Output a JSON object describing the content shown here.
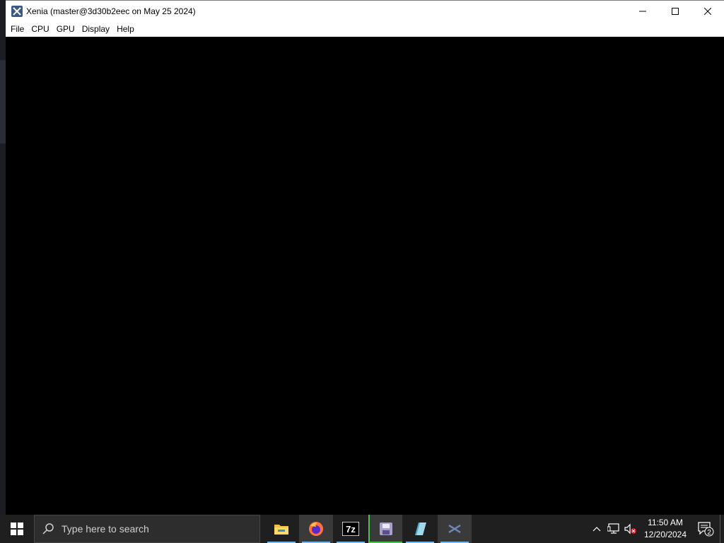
{
  "window": {
    "title": "Xenia (master@3d30b2eec on May 25 2024)",
    "menu": [
      "File",
      "CPU",
      "GPU",
      "Display",
      "Help"
    ]
  },
  "taskbar": {
    "search_placeholder": "Type here to search",
    "apps": [
      {
        "icon": "file-explorer-icon",
        "active": false
      },
      {
        "icon": "firefox-icon",
        "active": true
      },
      {
        "icon": "7zip-icon",
        "active": false
      },
      {
        "icon": "floppy-app-icon",
        "active": true
      },
      {
        "icon": "notepad-app-icon",
        "active": false
      },
      {
        "icon": "xenia-icon",
        "active": true
      }
    ],
    "clock": {
      "time": "11:50 AM",
      "date": "12/20/2024"
    },
    "notification_count": "2"
  },
  "colors": {
    "taskbar": "#1f1f1f",
    "accent": "#76b9ed",
    "titlebar": "#ffffff",
    "viewport": "#000000"
  }
}
